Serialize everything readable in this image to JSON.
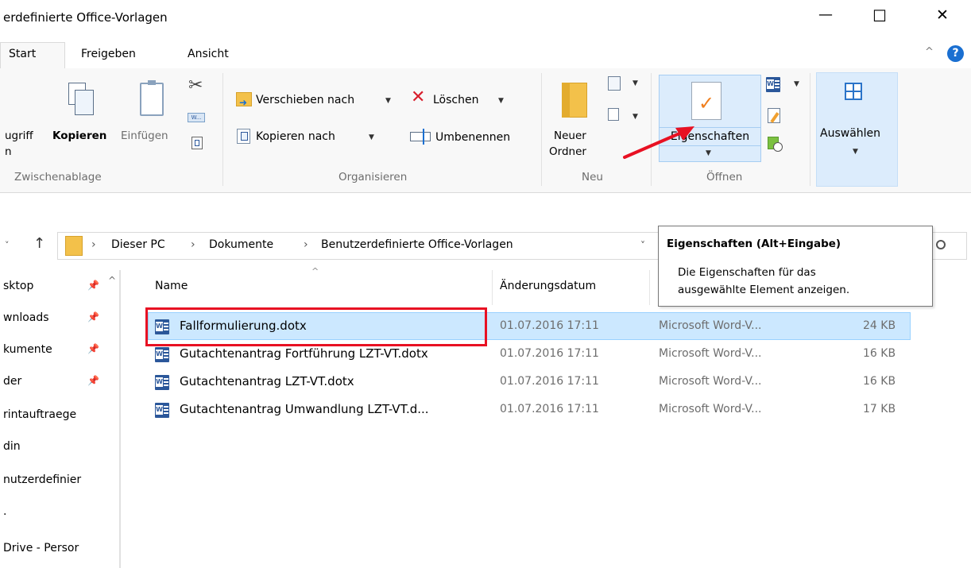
{
  "window": {
    "title": "erdefinierte Office-Vorlagen",
    "controls": {
      "minimize": "—",
      "maximize": "☐",
      "close": "✕"
    }
  },
  "tabs": [
    {
      "label": "Start"
    },
    {
      "label": "Freigeben"
    },
    {
      "label": "Ansicht"
    }
  ],
  "ribbon": {
    "clipboard": {
      "access_label_1": "ugriff",
      "access_label_2": "n",
      "copy_label": "Kopieren",
      "paste_label": "Einfügen",
      "group_label": "Zwischenablage"
    },
    "organize": {
      "move_label": "Verschieben nach",
      "copy_to_label": "Kopieren nach",
      "delete_label": "Löschen",
      "rename_label": "Umbenennen",
      "group_label": "Organisieren"
    },
    "new": {
      "new_folder_label_1": "Neuer",
      "new_folder_label_2": "Ordner",
      "group_label": "Neu"
    },
    "open": {
      "properties_label": "Eigenschaften",
      "group_label": "Öffnen"
    },
    "select": {
      "select_label": "Auswählen"
    }
  },
  "tooltip": {
    "title": "Eigenschaften (Alt+Eingabe)",
    "line1": "Die Eigenschaften für das",
    "line2": "ausgewählte Element anzeigen."
  },
  "address": {
    "crumbs": [
      "Dieser PC",
      "Dokumente",
      "Benutzerdefinierte Office-Vorlagen"
    ],
    "separator": "›"
  },
  "nav_pane": [
    {
      "label": "sktop",
      "pinned": true
    },
    {
      "label": "wnloads",
      "pinned": true
    },
    {
      "label": "kumente",
      "pinned": true
    },
    {
      "label": "der",
      "pinned": true
    },
    {
      "label": "rintauftraege",
      "pinned": false
    },
    {
      "label": "din",
      "pinned": false
    },
    {
      "label": "nutzerdefinier",
      "pinned": false
    },
    {
      "label": ".",
      "pinned": false
    },
    {
      "label": "Drive - Persor",
      "pinned": false
    }
  ],
  "columns": {
    "name": "Name",
    "date": "Änderungsdatum"
  },
  "files": [
    {
      "name": "Fallformulierung.dotx",
      "date": "01.07.2016 17:11",
      "type": "Microsoft Word-V...",
      "size": "24 KB"
    },
    {
      "name": "Gutachtenantrag Fortführung LZT-VT.dotx",
      "date": "01.07.2016 17:11",
      "type": "Microsoft Word-V...",
      "size": "16 KB"
    },
    {
      "name": "Gutachtenantrag LZT-VT.dotx",
      "date": "01.07.2016 17:11",
      "type": "Microsoft Word-V...",
      "size": "16 KB"
    },
    {
      "name": "Gutachtenantrag Umwandlung LZT-VT.d...",
      "date": "01.07.2016 17:11",
      "type": "Microsoft Word-V...",
      "size": "17 KB"
    }
  ],
  "colors": {
    "accent": "#0078d7",
    "selection": "#cce8ff",
    "highlight_box": "#e81123",
    "arrow": "#e81123"
  }
}
